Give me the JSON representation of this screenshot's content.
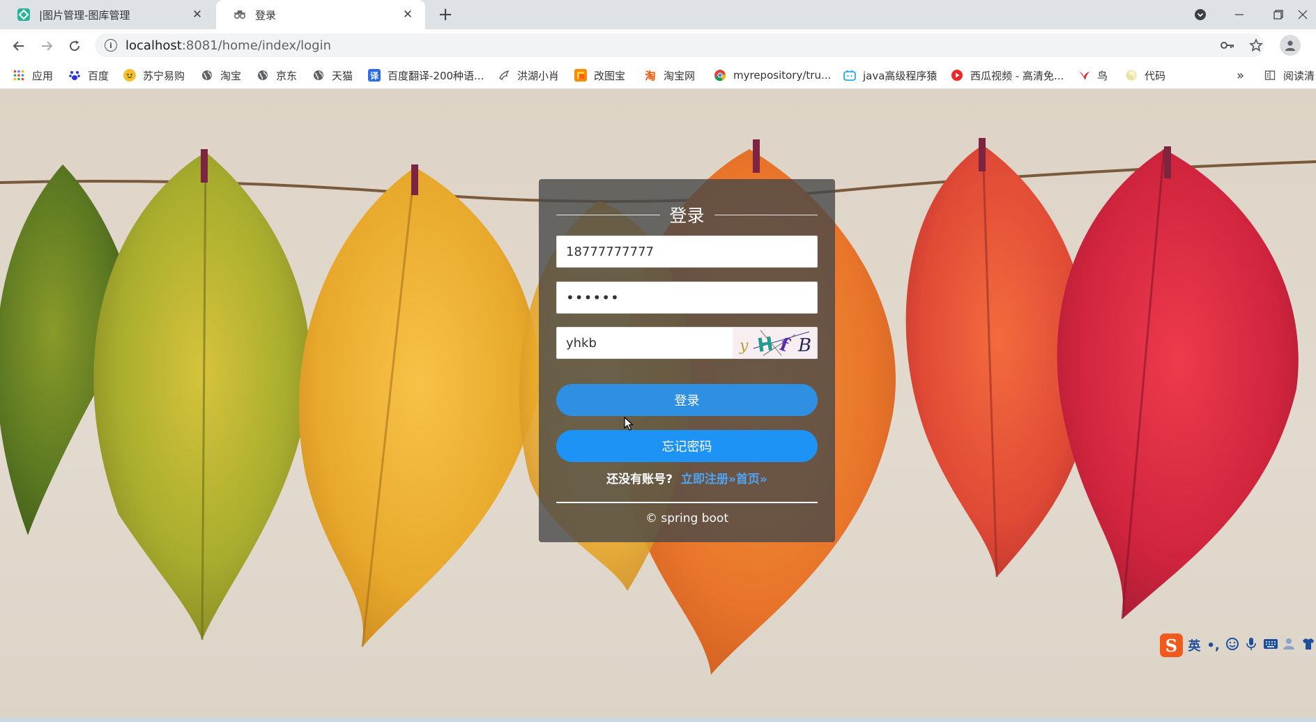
{
  "browser": {
    "tabs": [
      {
        "title": "|图片管理-图库管理",
        "close": "✕"
      },
      {
        "title": "登录",
        "close": "✕"
      }
    ],
    "new_tab": "+",
    "address": {
      "host": "localhost",
      "path": ":8081/home/index/login"
    },
    "bookmarks": [
      {
        "label": "应用",
        "icon": "apps-grid-icon"
      },
      {
        "label": "百度",
        "icon": "baidu-paw-icon"
      },
      {
        "label": "苏宁易购",
        "icon": "suning-icon"
      },
      {
        "label": "淘宝",
        "icon": "globe-icon"
      },
      {
        "label": "京东",
        "icon": "globe-icon"
      },
      {
        "label": "天猫",
        "icon": "globe-icon"
      },
      {
        "label": "百度翻译-200种语...",
        "icon": "translate-icon"
      },
      {
        "label": "洪湖小肖",
        "icon": "bird-icon"
      },
      {
        "label": "改图宝",
        "icon": "gaitubao-icon"
      },
      {
        "label": "淘宝网",
        "icon": "taobao-icon"
      },
      {
        "label": "myrepository/tru...",
        "icon": "chrome-icon"
      },
      {
        "label": "java高级程序猿",
        "icon": "bilibili-icon"
      },
      {
        "label": "西瓜视频 - 高清免...",
        "icon": "xigua-icon"
      },
      {
        "label": "鸟",
        "icon": "bird-red-icon"
      },
      {
        "label": "代码",
        "icon": "code-icon"
      }
    ],
    "bookmarks_overflow": "»",
    "reading_list": "阅读清"
  },
  "login": {
    "title": "登录",
    "username_value": "18777777777",
    "password_value": "••••••",
    "captcha_value": "yhkb",
    "captcha_image": [
      "y",
      "H",
      "f",
      "B"
    ],
    "login_button": "登录",
    "forgot_button": "忘记密码",
    "no_account_text": "还没有账号?",
    "signup_link": "立即注册»首页»",
    "copyright": "© spring boot"
  },
  "ime": {
    "language": "英",
    "punct": "•,"
  },
  "colors": {
    "login_button": "#2f8fe3",
    "forgot_button": "#1e93f6",
    "link": "#4ea4f5",
    "card_bg": "rgba(72,72,72,0.80)"
  }
}
